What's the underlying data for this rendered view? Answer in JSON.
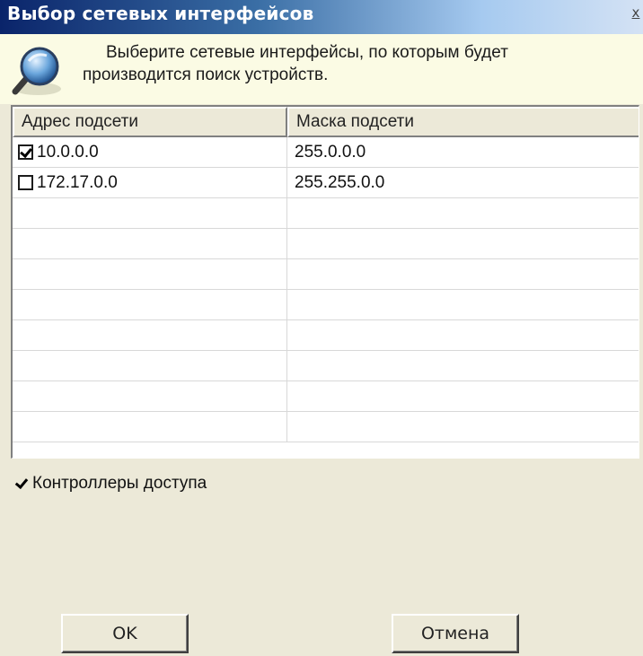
{
  "window": {
    "title": "Выбор сетевых интерфейсов",
    "close_label": "x"
  },
  "banner": {
    "icon": "network-search-icon",
    "line1": "Выберите сетевые интерфейсы,  по которым будет",
    "line2": "производится поиск устройств."
  },
  "table": {
    "columns": [
      "Адрес подсети",
      "Маска подсети"
    ],
    "rows": [
      {
        "checked": true,
        "address": "10.0.0.0",
        "mask": "255.0.0.0"
      },
      {
        "checked": false,
        "address": "172.17.0.0",
        "mask": "255.255.0.0"
      }
    ],
    "empty_rows": 8
  },
  "access_controllers": {
    "checked": true,
    "label": "Контроллеры доступа"
  },
  "buttons": {
    "ok": "OK",
    "cancel": "Отмена"
  }
}
